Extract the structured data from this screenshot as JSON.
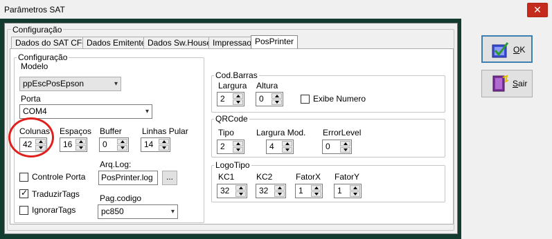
{
  "window": {
    "title": "Parâmetros SAT",
    "close_glyph": "✕"
  },
  "config_group": {
    "legend": "Configuração"
  },
  "tabs": [
    {
      "label": "Dados do SAT CFe",
      "active": false
    },
    {
      "label": "Dados Emitente",
      "active": false
    },
    {
      "label": "Dados Sw.House",
      "active": false
    },
    {
      "label": "Impressao",
      "active": false
    },
    {
      "label": "PosPrinter",
      "active": true
    }
  ],
  "posprinter": {
    "legend": "Configuração",
    "modelo": {
      "label": "Modelo",
      "value": "ppEscPosEpson"
    },
    "porta": {
      "label": "Porta",
      "value": "COM4"
    },
    "colunas": {
      "label": "Colunas",
      "value": "42"
    },
    "espacos": {
      "label": "Espaços",
      "value": "16"
    },
    "buffer": {
      "label": "Buffer",
      "value": "0"
    },
    "linhas_pular": {
      "label": "Linhas Pular",
      "value": "14"
    },
    "controle_porta": {
      "label": "Controle Porta",
      "checked": false
    },
    "traduzir_tags": {
      "label": "TraduzirTags",
      "checked": true
    },
    "ignorar_tags": {
      "label": "IgnorarTags",
      "checked": false
    },
    "arq_log": {
      "label": "Arq.Log:",
      "value": "PosPrinter.log",
      "browse_label": "..."
    },
    "pag_codigo": {
      "label": "Pag.codigo",
      "value": "pc850"
    }
  },
  "codbarras": {
    "legend": "Cod.Barras",
    "largura": {
      "label": "Largura",
      "value": "2"
    },
    "altura": {
      "label": "Altura",
      "value": "0"
    },
    "exibe_numero": {
      "label": "Exibe Numero",
      "checked": false
    }
  },
  "qrcode": {
    "legend": "QRCode",
    "tipo": {
      "label": "Tipo",
      "value": "2"
    },
    "largura_mod": {
      "label": "Largura Mod.",
      "value": "4"
    },
    "error_level": {
      "label": "ErrorLevel",
      "value": "0"
    }
  },
  "logotipo": {
    "legend": "LogoTipo",
    "kc1": {
      "label": "KC1",
      "value": "32"
    },
    "kc2": {
      "label": "KC2",
      "value": "32"
    },
    "fatorx": {
      "label": "FatorX",
      "value": "1"
    },
    "fatory": {
      "label": "FatorY",
      "value": "1"
    }
  },
  "buttons": {
    "ok": {
      "label": "OK",
      "mnemonic": "O",
      "rest": "K"
    },
    "sair": {
      "label": "Sair",
      "mnemonic": "S",
      "rest": "air"
    }
  },
  "colors": {
    "frame": "#133c31",
    "highlight_circle": "#e0201c",
    "close": "#c42b1c"
  }
}
